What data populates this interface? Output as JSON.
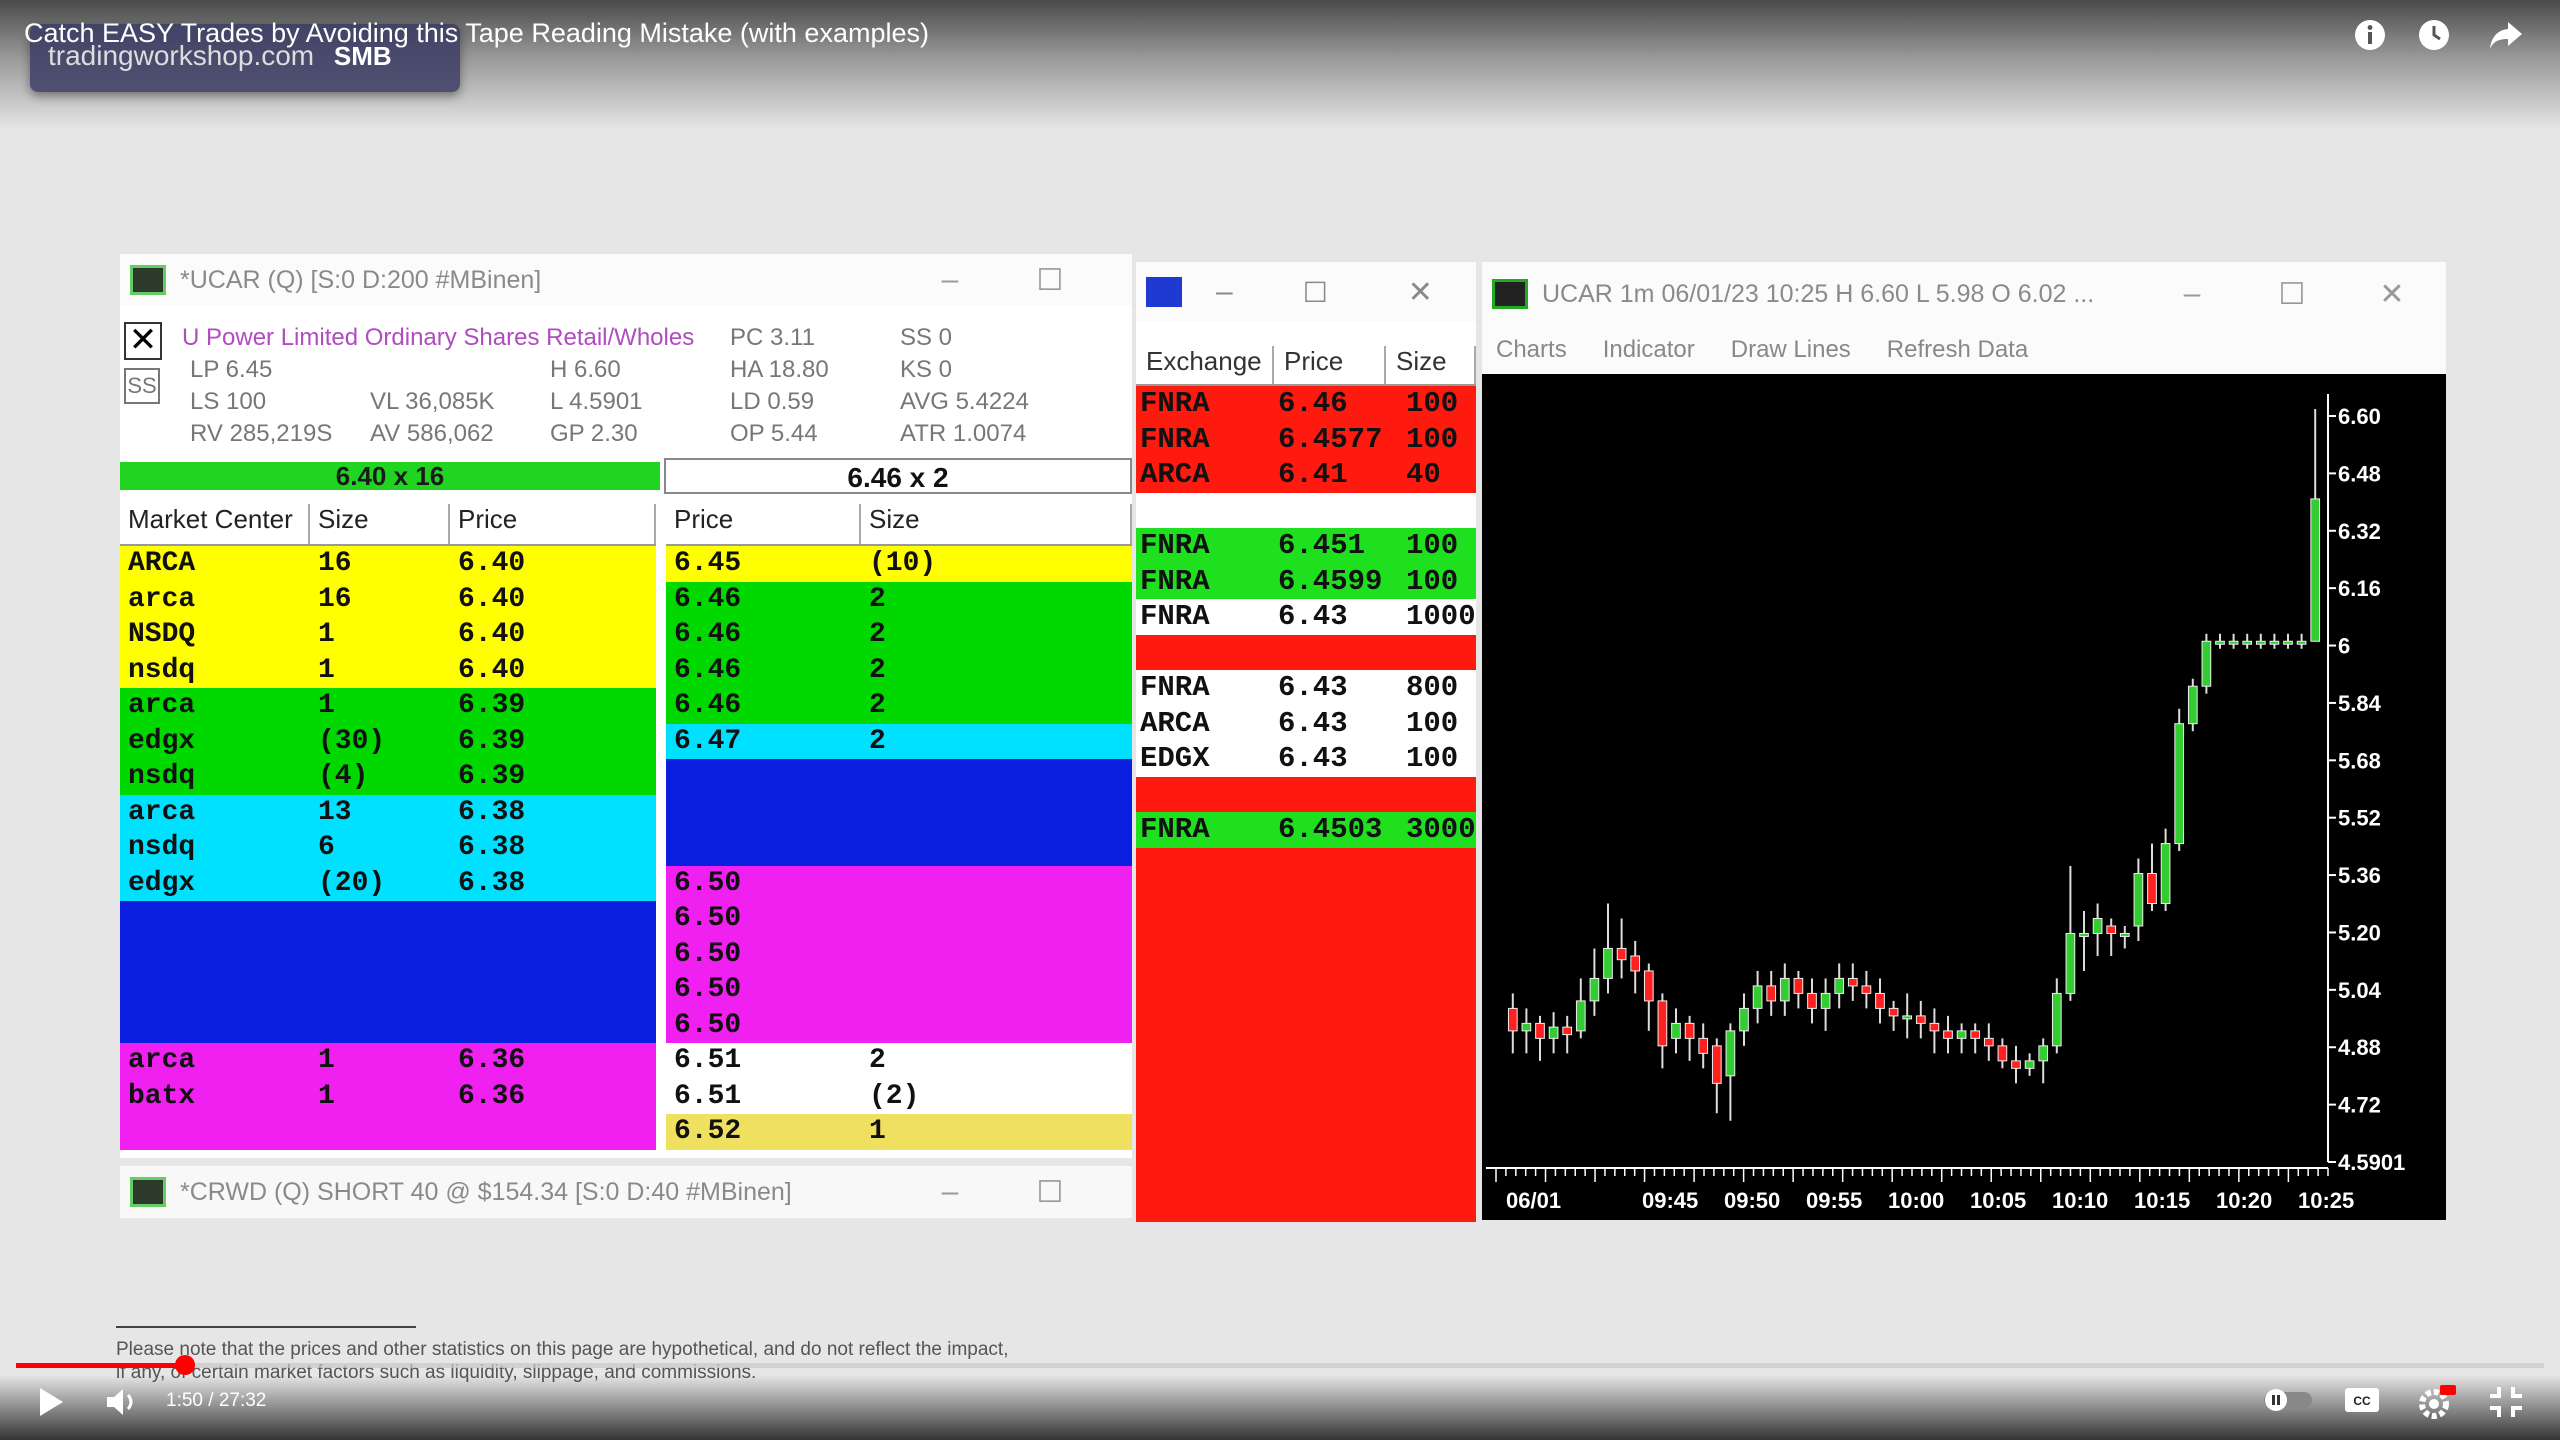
{
  "video": {
    "title": "Catch EASY Trades by Avoiding this Tape Reading Mistake (with examples)",
    "watermark_site": "tradingworkshop.com",
    "watermark_brand": "SMB",
    "time": "1:50 / 27:32",
    "progress_percent": 6.7,
    "disclaimer": "Please note that the prices and other statistics on this page are hypothetical, and do not reflect the impact, if any, of certain market factors such as liquidity, slippage, and commissions."
  },
  "level2": {
    "title": "*UCAR (Q)  [S:0 D:200 #MBinen]",
    "company": "U Power Limited  Ordinary Shares  Retail/Wholes",
    "info": {
      "lp": "LP  6.45",
      "ls": "LS  100",
      "rv": "RV  285,219S",
      "vl": "VL  36,085K",
      "av": "AV  586,062",
      "h": "H   6.60",
      "l": "L   4.5901",
      "gp": "GP  2.30",
      "pc": "PC  3.11",
      "ha": "HA  18.80",
      "ld": "LD  0.59",
      "op": "OP  5.44",
      "ss": "SS    0",
      "ks": "KS    0",
      "avg": "AVG  5.4224",
      "atr": "ATR  1.0074"
    },
    "bid": "6.40 x 16",
    "ask": "6.46 x 2",
    "bid_headers": [
      "Market Center",
      "Size",
      "Price"
    ],
    "ask_headers": [
      "Price",
      "Size"
    ],
    "bids": [
      {
        "mm": "ARCA",
        "size": "16",
        "price": "6.40",
        "color": "#ffff00"
      },
      {
        "mm": "arca",
        "size": "16",
        "price": "6.40",
        "color": "#ffff00"
      },
      {
        "mm": "NSDQ",
        "size": "1",
        "price": "6.40",
        "color": "#ffff00"
      },
      {
        "mm": "nsdq",
        "size": "1",
        "price": "6.40",
        "color": "#ffff00"
      },
      {
        "mm": "arca",
        "size": "1",
        "price": "6.39",
        "color": "#00d800"
      },
      {
        "mm": "edgx",
        "size": "(30)",
        "price": "6.39",
        "color": "#00d800"
      },
      {
        "mm": "nsdq",
        "size": "(4)",
        "price": "6.39",
        "color": "#00d800"
      },
      {
        "mm": "arca",
        "size": "13",
        "price": "6.38",
        "color": "#00e0ff"
      },
      {
        "mm": "nsdq",
        "size": "6",
        "price": "6.38",
        "color": "#00e0ff"
      },
      {
        "mm": "edgx",
        "size": "(20)",
        "price": "6.38",
        "color": "#00e0ff"
      },
      {
        "mm": "",
        "size": "",
        "price": "",
        "color": "#0a1ee0"
      },
      {
        "mm": "",
        "size": "",
        "price": "",
        "color": "#0a1ee0"
      },
      {
        "mm": "",
        "size": "",
        "price": "",
        "color": "#0a1ee0"
      },
      {
        "mm": "",
        "size": "",
        "price": "",
        "color": "#0a1ee0"
      },
      {
        "mm": "arca",
        "size": "1",
        "price": "6.36",
        "color": "#f020f0"
      },
      {
        "mm": "batx",
        "size": "1",
        "price": "6.36",
        "color": "#f020f0"
      },
      {
        "mm": "",
        "size": "",
        "price": "",
        "color": "#f020f0"
      }
    ],
    "asks": [
      {
        "price": "6.45",
        "size": "(10)",
        "color": "#ffff00"
      },
      {
        "price": "6.46",
        "size": "2",
        "color": "#00d800"
      },
      {
        "price": "6.46",
        "size": "2",
        "color": "#00d800"
      },
      {
        "price": "6.46",
        "size": "2",
        "color": "#00d800"
      },
      {
        "price": "6.46",
        "size": "2",
        "color": "#00d800"
      },
      {
        "price": "6.47",
        "size": "2",
        "color": "#00e0ff"
      },
      {
        "price": "",
        "size": "",
        "color": "#0a1ee0"
      },
      {
        "price": "",
        "size": "",
        "color": "#0a1ee0"
      },
      {
        "price": "",
        "size": "",
        "color": "#0a1ee0"
      },
      {
        "price": "6.50",
        "size": "",
        "color": "#f020f0"
      },
      {
        "price": "6.50",
        "size": "",
        "color": "#f020f0"
      },
      {
        "price": "6.50",
        "size": "",
        "color": "#f020f0"
      },
      {
        "price": "6.50",
        "size": "",
        "color": "#f020f0"
      },
      {
        "price": "6.50",
        "size": "",
        "color": "#f020f0"
      },
      {
        "price": "6.51",
        "size": "2",
        "color": "#ffffff"
      },
      {
        "price": "6.51",
        "size": "(2)",
        "color": "#ffffff"
      },
      {
        "price": "6.52",
        "size": "1",
        "color": "#f0e060"
      }
    ]
  },
  "crwd": {
    "title": "*CRWD (Q)  SHORT 40 @ $154.34  [S:0 D:40 #MBinen]"
  },
  "ts": {
    "headers": [
      "Exchange",
      "Price",
      "Size"
    ],
    "rows": [
      {
        "ex": "FNRA",
        "price": "6.46",
        "size": "100",
        "color": "#ff1a10"
      },
      {
        "ex": "FNRA",
        "price": "6.4577",
        "size": "100",
        "color": "#ff1a10"
      },
      {
        "ex": "ARCA",
        "price": "6.41",
        "size": "40",
        "color": "#ff1a10"
      },
      {
        "ex": "",
        "price": "",
        "size": "",
        "color": "#ffffff"
      },
      {
        "ex": "FNRA",
        "price": "6.451",
        "size": "100",
        "color": "#1ee01e"
      },
      {
        "ex": "FNRA",
        "price": "6.4599",
        "size": "100",
        "color": "#1ee01e"
      },
      {
        "ex": "FNRA",
        "price": "6.43",
        "size": "1000",
        "color": "#ffffff"
      },
      {
        "ex": "",
        "price": "",
        "size": "",
        "color": "#ff1a10"
      },
      {
        "ex": "FNRA",
        "price": "6.43",
        "size": "800",
        "color": "#ffffff"
      },
      {
        "ex": "ARCA",
        "price": "6.43",
        "size": "100",
        "color": "#ffffff"
      },
      {
        "ex": "EDGX",
        "price": "6.43",
        "size": "100",
        "color": "#ffffff"
      },
      {
        "ex": "",
        "price": "",
        "size": "",
        "color": "#ff1a10"
      },
      {
        "ex": "FNRA",
        "price": "6.4503",
        "size": "3000",
        "color": "#1ee01e"
      },
      {
        "ex": "",
        "price": "",
        "size": "",
        "color": "#ff1a10"
      },
      {
        "ex": "",
        "price": "",
        "size": "",
        "color": "#ff1a10"
      },
      {
        "ex": "",
        "price": "",
        "size": "",
        "color": "#ff1a10"
      },
      {
        "ex": "",
        "price": "",
        "size": "",
        "color": "#ff1a10"
      },
      {
        "ex": "",
        "price": "",
        "size": "",
        "color": "#ff1a10"
      },
      {
        "ex": "",
        "price": "",
        "size": "",
        "color": "#ff1a10"
      },
      {
        "ex": "",
        "price": "",
        "size": "",
        "color": "#ff1a10"
      },
      {
        "ex": "",
        "price": "",
        "size": "",
        "color": "#ff1a10"
      },
      {
        "ex": "",
        "price": "",
        "size": "",
        "color": "#ff1a10"
      },
      {
        "ex": "",
        "price": "",
        "size": "",
        "color": "#ff1a10"
      },
      {
        "ex": "",
        "price": "",
        "size": "",
        "color": "#ff1a10"
      }
    ]
  },
  "chart": {
    "title": "UCAR  1m  06/01/23  10:25  H 6.60  L 5.98  O 6.02 ...",
    "menu": [
      "Charts",
      "Indicator",
      "Draw Lines",
      "Refresh Data"
    ],
    "y_ticks": [
      "6.60",
      "6.48",
      "6.32",
      "6.16",
      "6",
      "5.84",
      "5.68",
      "5.52",
      "5.36",
      "5.20",
      "5.04",
      "4.88",
      "4.72",
      "4.5901"
    ],
    "x_ticks": [
      "06/01",
      "09:45",
      "09:50",
      "09:55",
      "10:00",
      "10:05",
      "10:10",
      "10:15",
      "10:20",
      "10:25"
    ]
  },
  "chart_data": {
    "type": "candlestick",
    "title": "UCAR 1m",
    "ylim": [
      4.59,
      6.64
    ],
    "up_color": "#33cc33",
    "down_color": "#ff2020",
    "candles": [
      [
        5.0,
        4.94,
        5.04,
        4.88
      ],
      [
        4.94,
        4.96,
        5.0,
        4.88
      ],
      [
        4.96,
        4.92,
        4.98,
        4.86
      ],
      [
        4.92,
        4.95,
        4.99,
        4.88
      ],
      [
        4.95,
        4.93,
        4.98,
        4.88
      ],
      [
        4.94,
        5.02,
        5.08,
        4.92
      ],
      [
        5.02,
        5.08,
        5.16,
        4.98
      ],
      [
        5.08,
        5.16,
        5.28,
        5.04
      ],
      [
        5.16,
        5.13,
        5.24,
        5.08
      ],
      [
        5.14,
        5.1,
        5.18,
        5.04
      ],
      [
        5.1,
        5.02,
        5.12,
        4.94
      ],
      [
        5.02,
        4.9,
        5.04,
        4.84
      ],
      [
        4.92,
        4.96,
        5.0,
        4.88
      ],
      [
        4.96,
        4.92,
        4.98,
        4.86
      ],
      [
        4.92,
        4.88,
        4.96,
        4.84
      ],
      [
        4.9,
        4.8,
        4.92,
        4.72
      ],
      [
        4.82,
        4.94,
        4.96,
        4.7
      ],
      [
        4.94,
        5.0,
        5.04,
        4.9
      ],
      [
        5.0,
        5.06,
        5.1,
        4.96
      ],
      [
        5.06,
        5.02,
        5.1,
        4.98
      ],
      [
        5.02,
        5.08,
        5.12,
        4.98
      ],
      [
        5.08,
        5.04,
        5.1,
        5.0
      ],
      [
        5.04,
        5.0,
        5.08,
        4.96
      ],
      [
        5.0,
        5.04,
        5.08,
        4.94
      ],
      [
        5.04,
        5.08,
        5.12,
        5.0
      ],
      [
        5.08,
        5.06,
        5.12,
        5.02
      ],
      [
        5.06,
        5.04,
        5.1,
        5.0
      ],
      [
        5.04,
        5.0,
        5.08,
        4.96
      ],
      [
        5.0,
        4.98,
        5.02,
        4.94
      ],
      [
        4.98,
        4.98,
        5.04,
        4.92
      ],
      [
        4.98,
        4.96,
        5.02,
        4.92
      ],
      [
        4.96,
        4.94,
        5.0,
        4.88
      ],
      [
        4.94,
        4.92,
        4.98,
        4.88
      ],
      [
        4.92,
        4.94,
        4.96,
        4.88
      ],
      [
        4.94,
        4.92,
        4.96,
        4.88
      ],
      [
        4.92,
        4.9,
        4.96,
        4.86
      ],
      [
        4.9,
        4.86,
        4.92,
        4.84
      ],
      [
        4.86,
        4.84,
        4.9,
        4.8
      ],
      [
        4.84,
        4.86,
        4.88,
        4.82
      ],
      [
        4.86,
        4.9,
        4.92,
        4.8
      ],
      [
        4.9,
        5.04,
        5.08,
        4.88
      ],
      [
        5.04,
        5.2,
        5.38,
        5.02
      ],
      [
        5.2,
        5.2,
        5.26,
        5.1
      ],
      [
        5.2,
        5.24,
        5.28,
        5.14
      ],
      [
        5.22,
        5.2,
        5.24,
        5.14
      ],
      [
        5.2,
        5.2,
        5.22,
        5.16
      ],
      [
        5.22,
        5.36,
        5.4,
        5.18
      ],
      [
        5.36,
        5.28,
        5.44,
        5.26
      ],
      [
        5.28,
        5.44,
        5.48,
        5.26
      ],
      [
        5.44,
        5.76,
        5.8,
        5.42
      ],
      [
        5.76,
        5.86,
        5.88,
        5.74
      ],
      [
        5.86,
        5.98,
        6.0,
        5.84
      ],
      [
        5.98,
        5.98,
        6.0,
        5.96
      ],
      [
        5.98,
        5.98,
        6.0,
        5.96
      ],
      [
        5.98,
        5.98,
        6.0,
        5.96
      ],
      [
        5.98,
        5.98,
        6.0,
        5.96
      ],
      [
        5.98,
        5.98,
        6.0,
        5.96
      ],
      [
        5.98,
        5.98,
        6.0,
        5.96
      ],
      [
        5.98,
        5.98,
        6.0,
        5.96
      ],
      [
        5.98,
        6.36,
        6.6,
        5.98
      ]
    ]
  }
}
